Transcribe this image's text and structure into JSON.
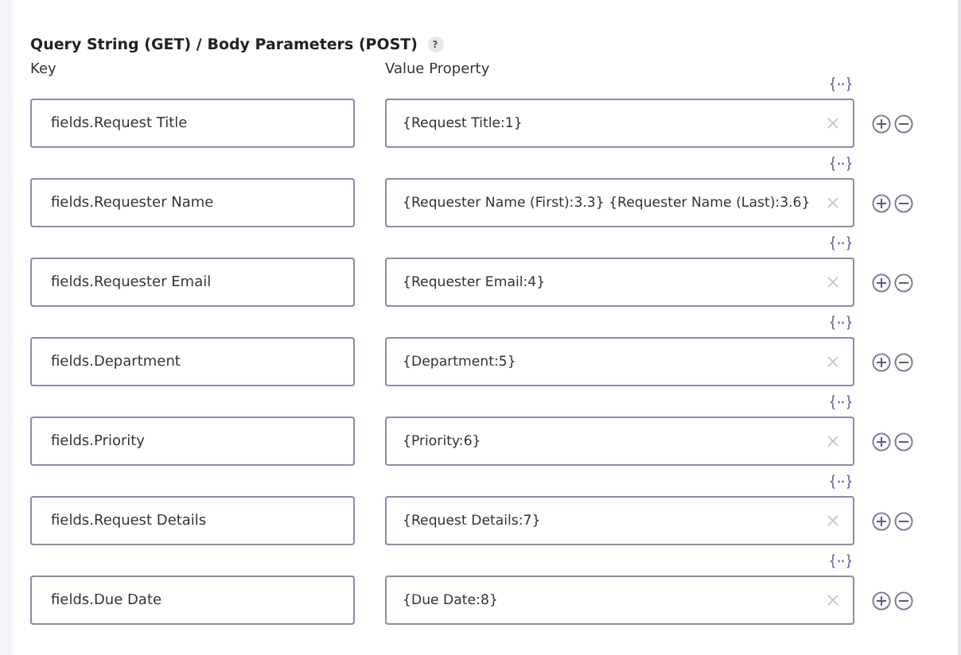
{
  "section": {
    "title": "Query String (GET) / Body Parameters (POST)",
    "help": "?"
  },
  "columns": {
    "key": "Key",
    "value": "Value Property"
  },
  "rows": [
    {
      "key": "fields.Request Title",
      "value": "{Request Title:1}"
    },
    {
      "key": "fields.Requester Name",
      "value": "{Requester Name (First):3.3} {Requester Name (Last):3.6}"
    },
    {
      "key": "fields.Requester Email",
      "value": "{Requester Email:4}"
    },
    {
      "key": "fields.Department",
      "value": "{Department:5}"
    },
    {
      "key": "fields.Priority",
      "value": "{Priority:6}"
    },
    {
      "key": "fields.Request Details",
      "value": "{Request Details:7}"
    },
    {
      "key": "fields.Due Date",
      "value": "{Due Date:8}"
    }
  ]
}
